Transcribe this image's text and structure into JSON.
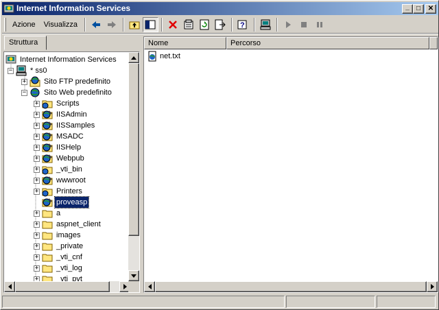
{
  "window": {
    "title": "Internet Information Services",
    "minimize": "_",
    "maximize": "□",
    "close": "✕"
  },
  "menu": {
    "action": "Azione",
    "view": "Visualizza"
  },
  "toolbar": {
    "icons": [
      "back-arrow-icon",
      "forward-arrow-icon",
      "up-folder-icon",
      "show-hide-tree-icon",
      "delete-icon",
      "properties-icon",
      "refresh-icon",
      "export-list-icon",
      "help-icon",
      "computer-icon",
      "play-icon",
      "stop-icon",
      "pause-icon"
    ]
  },
  "tab": {
    "label": "Struttura"
  },
  "tree": {
    "root": "Internet Information Services",
    "server": "* ss0",
    "ftp": "Sito FTP predefinito",
    "web": "Sito Web predefinito",
    "children": [
      "Scripts",
      "IISAdmin",
      "IISSamples",
      "MSADC",
      "IISHelp",
      "Webpub",
      "_vti_bin",
      "wwwroot",
      "Printers",
      "proveasp",
      "a",
      "aspnet_client",
      "images",
      "_private",
      "_vti_cnf",
      "_vti_log",
      "_vti_pvt"
    ],
    "selected": "proveasp"
  },
  "list": {
    "columns": [
      "Nome",
      "Percorso"
    ],
    "rows": [
      {
        "name": "net.txt",
        "path": ""
      }
    ]
  },
  "colors": {
    "titlebar_start": "#0a246a",
    "titlebar_end": "#a6caf0",
    "selection": "#0a246a",
    "chrome": "#d4d0c8"
  }
}
